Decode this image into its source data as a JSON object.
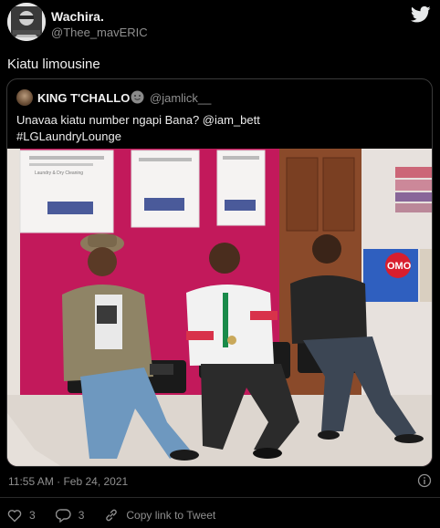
{
  "author": {
    "name": "Wachira.",
    "handle": "@Thee_mavERIC"
  },
  "tweet": {
    "text": "Kiatu limousine"
  },
  "quoted": {
    "name": "KING T'CHALLO",
    "handle": "@jamlick__",
    "text_line1": "Unavaa kiatu number ngapi Bana? @iam_bett",
    "text_line2": "#LGLaundryLounge"
  },
  "photo": {
    "poster1_title": "Laundry & Dry Cleaning",
    "poster_brand": "OMO",
    "box_brand": "OMO"
  },
  "meta": {
    "timestamp": "11:55 AM · Feb 24, 2021"
  },
  "actions": {
    "likes": "3",
    "replies": "3",
    "copy_label": "Copy link to Tweet"
  },
  "colors": {
    "background": "#000000",
    "wall": "#c4185a",
    "muted_text": "#8f8f8f"
  },
  "icons": [
    "twitter-bird-icon",
    "info-icon",
    "heart-icon",
    "reply-icon",
    "link-icon"
  ]
}
